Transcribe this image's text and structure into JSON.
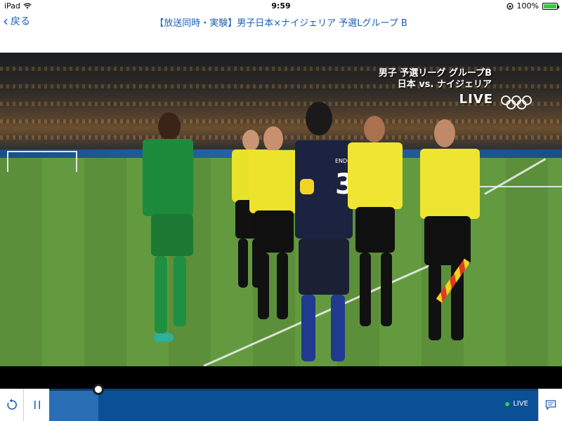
{
  "status_bar": {
    "device": "iPad",
    "time": "9:59",
    "battery": "100%",
    "battery_level": 1.0
  },
  "nav": {
    "back_label": "戻る",
    "title": "【放送同時・実験】男子日本×ナイジェリア 予選Lグループ B"
  },
  "video": {
    "overlay_line1": "男子 予選リーグ グループB",
    "overlay_line2": "日本 vs. ナイジェリア",
    "live_badge": "LIVE",
    "jersey_number": "3",
    "jersey_name": "ENDO"
  },
  "controls": {
    "progress": 0.1,
    "live_label": "LIVE"
  },
  "colors": {
    "accent": "#1a5fb4",
    "timeline": "#0b4f97",
    "live_dot": "#2ecc55"
  }
}
